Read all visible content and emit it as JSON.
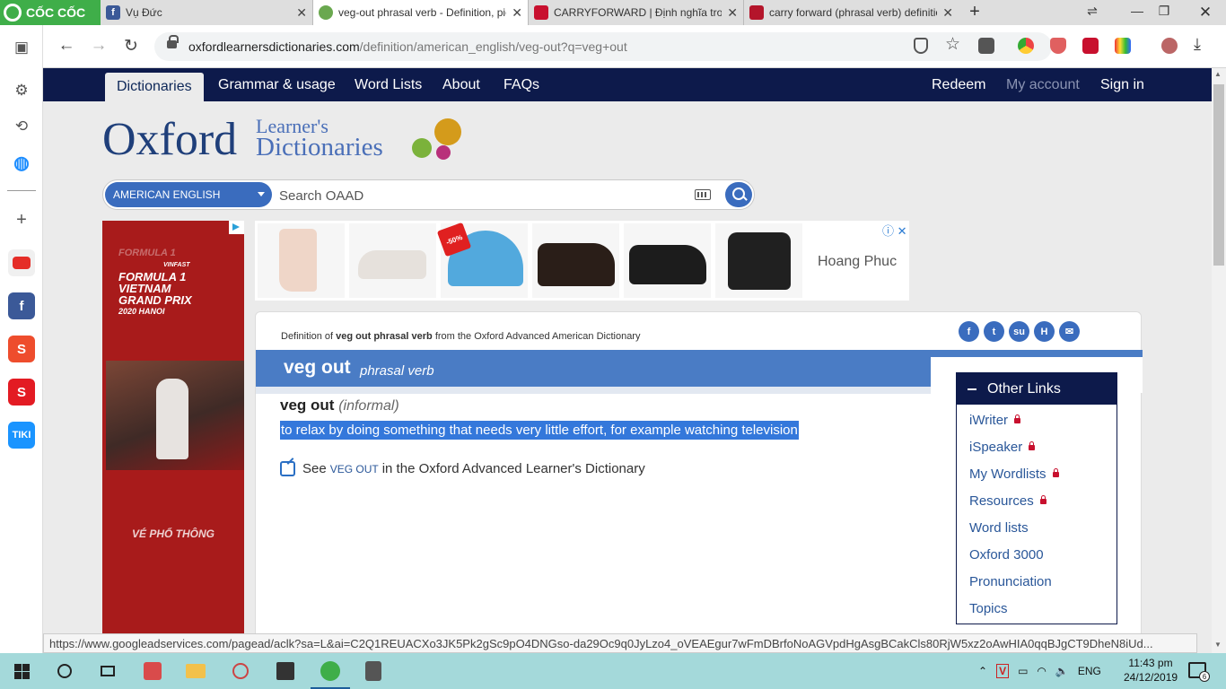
{
  "browser": {
    "brand": "CỐC CỐC",
    "tabs": [
      {
        "title": "Vụ Đức",
        "favicon": "facebook-icon",
        "color": "#3b5998"
      },
      {
        "title": "veg-out phrasal verb - Definition, pictures, pronunciation and usage notes",
        "favicon": "oxford-favicon-icon",
        "color": "#6aa84f"
      },
      {
        "title": "CARRYFORWARD | Định nghĩa trong Từ điển",
        "favicon": "cambridge-icon",
        "color": "#c8102e"
      },
      {
        "title": "carry forward (phrasal verb) definition",
        "favicon": "macmillan-icon",
        "color": "#b4152b"
      }
    ],
    "url_host": "oxfordlearnersdictionaries.com",
    "url_path": "/definition/american_english/veg-out?q=veg+out",
    "status_url": "https://www.googleadservices.com/pagead/aclk?sa=L&ai=C2Q1REUACXo3JK5Pk2gSc9pO4DNGso-da29Oc9q0JyLzo4_oVEAEgur7wFmDBrfoNoAGVpdHgAsgBCakCls80RjW5xz2oAwHIA0qqBJgCT9DheN8iUd..."
  },
  "site": {
    "nav": {
      "tab_dictionaries": "Dictionaries",
      "tab_grammar": "Grammar & usage",
      "tab_wordlists": "Word Lists",
      "tab_about": "About",
      "tab_faqs": "FAQs",
      "redeem": "Redeem",
      "my_account": "My account",
      "sign_in": "Sign in"
    },
    "logo": {
      "oxford": "Oxford",
      "line1": "Learner's",
      "line2": "Dictionaries"
    },
    "search": {
      "dictionary": "AMERICAN ENGLISH",
      "placeholder": "Search OAAD"
    }
  },
  "ads": {
    "left": {
      "line1": "FORMULA 1",
      "line2": "VINFAST",
      "line3": "VIETNAM",
      "line4": "GRAND PRIX",
      "line5": "2020 HANOI",
      "footer": "VÉ PHỔ THÔNG"
    },
    "top": {
      "advertiser": "Hoang Phuc",
      "sale_badge": "-50%"
    }
  },
  "entry": {
    "crumb_prefix": "Definition of",
    "crumb_word": "veg out phrasal verb",
    "crumb_suffix": "from the Oxford Advanced American Dictionary",
    "headword": "veg out",
    "pos": "phrasal verb",
    "sense_headword": "veg out",
    "register": "(informal)",
    "definition": "to relax by doing something that needs very little effort, for example watching television",
    "see_prefix": "See",
    "see_word": "VEG OUT",
    "see_suffix": "in the Oxford Advanced Learner's Dictionary"
  },
  "other_links": {
    "title": "Other Links",
    "items": [
      "iWriter",
      "iSpeaker",
      "My Wordlists",
      "Resources",
      "Word lists",
      "Oxford 3000",
      "Pronunciation",
      "Topics"
    ],
    "locked": [
      true,
      true,
      true,
      true,
      false,
      false,
      false,
      false
    ]
  },
  "taskbar": {
    "language": "ENG",
    "time": "11:43 pm",
    "date": "24/12/2019",
    "notifications": "6"
  }
}
